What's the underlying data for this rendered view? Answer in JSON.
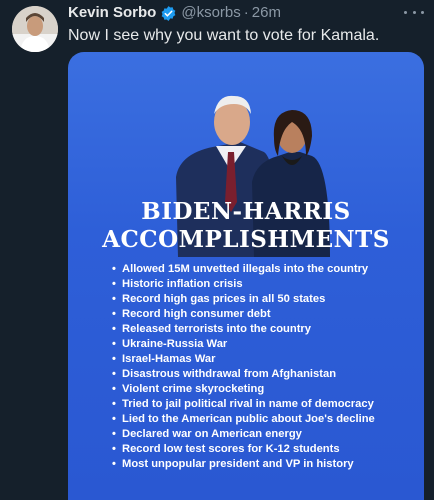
{
  "author": {
    "display_name": "Kevin Sorbo",
    "handle": "@ksorbs",
    "separator": "·",
    "time": "26m",
    "verified_icon": "verified-badge-icon",
    "verified_color": "#1d9bf0"
  },
  "tweet": {
    "text": "Now I see why you want to vote for Kamala."
  },
  "menu": {
    "icon": "more-options-icon"
  },
  "image": {
    "title_line_1": "BIDEN-HARRIS",
    "title_line_2": "ACCOMPLISHMENTS",
    "bullet": "•",
    "background_color": "#2e5fd8",
    "items": [
      "Allowed 15M unvetted illegals into the country",
      "Historic inflation crisis",
      "Record high gas prices in all 50 states",
      "Record high consumer debt",
      "Released terrorists into the country",
      "Ukraine-Russia War",
      "Israel-Hamas War",
      "Disastrous withdrawal from Afghanistan",
      "Violent crime skyrocketing",
      "Tried to jail political rival in name of democracy",
      "Lied to the American public about Joe's decline",
      "Declared war on American energy",
      "Record low test scores for K-12 students",
      "Most unpopular president and VP in history"
    ]
  },
  "colors": {
    "background": "#15202b",
    "primary_text": "#e7e9ea",
    "secondary_text": "#8b98a5"
  }
}
